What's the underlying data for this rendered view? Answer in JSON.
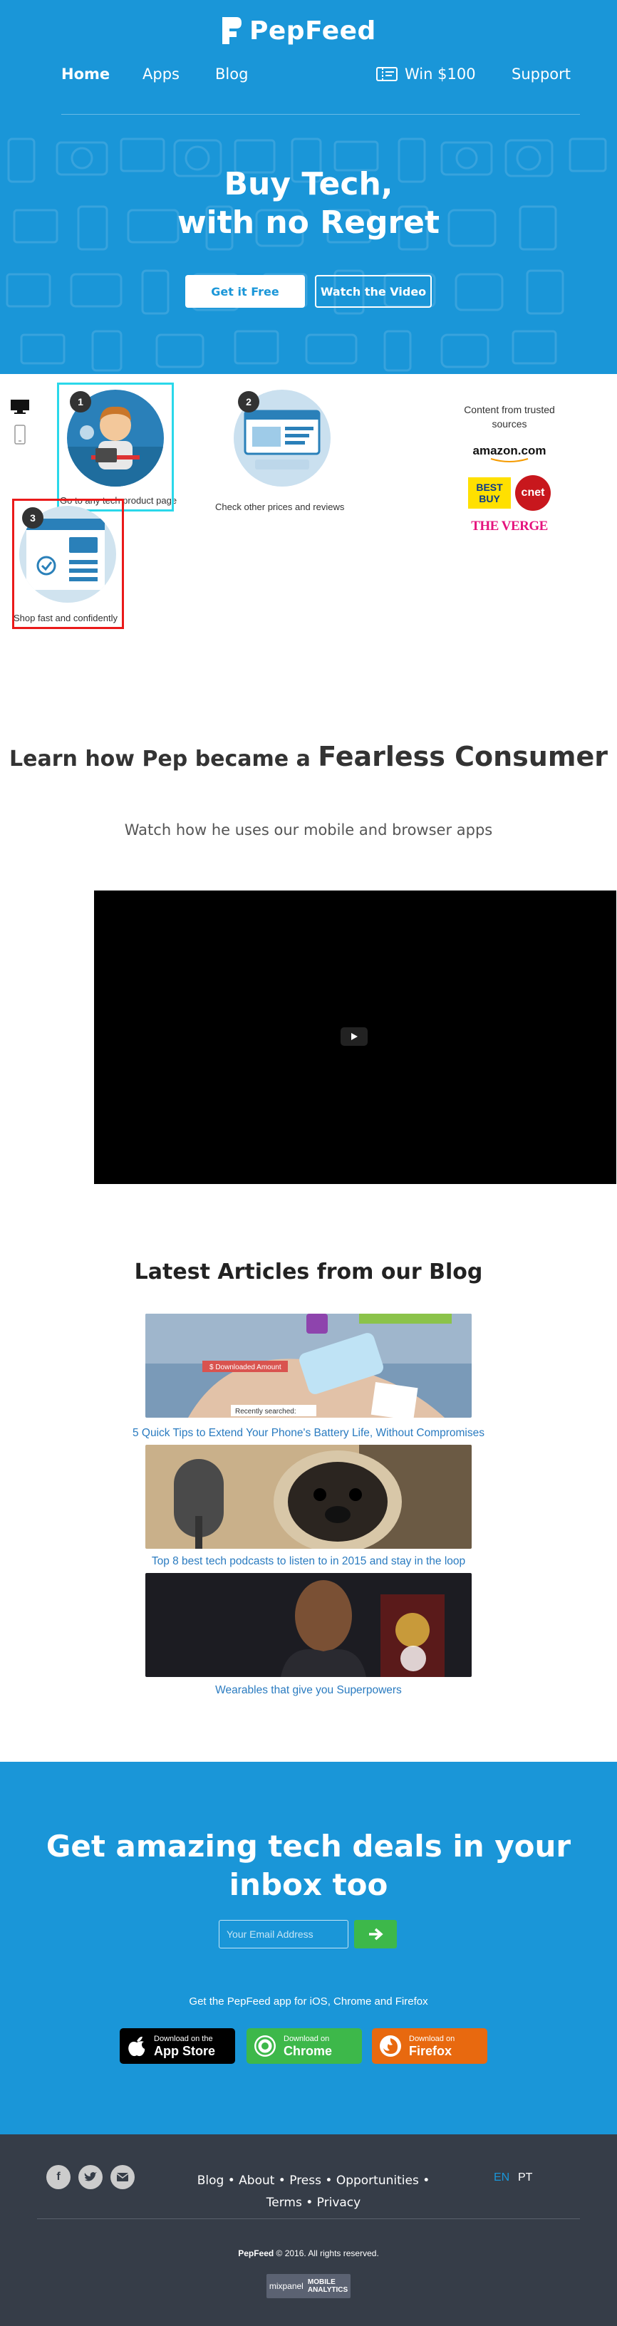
{
  "header": {
    "logo_text": "PepFeed",
    "nav": {
      "home": "Home",
      "apps": "Apps",
      "blog": "Blog",
      "win": "Win $100",
      "support": "Support"
    }
  },
  "hero": {
    "title_line1": "Buy Tech,",
    "title_line2": "with no Regret",
    "get_free_label": "Get it Free",
    "watch_video_label": "Watch the Video"
  },
  "steps": [
    {
      "number": "1",
      "label": "Go to any tech product page"
    },
    {
      "number": "2",
      "label": "Check other prices and reviews"
    },
    {
      "number": "3",
      "label": "Shop fast and confidently"
    }
  ],
  "trusted": {
    "caption": "Content from trusted sources",
    "sources": [
      "amazon.com",
      "BEST BUY",
      "cnet",
      "THE VERGE"
    ]
  },
  "learn": {
    "heading_prefix": "Learn how Pep became a",
    "heading_bold": "Fearless Consumer",
    "subtitle": "Watch how he uses our mobile and browser apps"
  },
  "blog": {
    "title": "Latest Articles from our Blog",
    "articles": [
      {
        "title": "5 Quick Tips to Extend Your Phone's Battery Life, Without Compromises",
        "badge": "$ Downloaded Amount",
        "search_label": "Recently searched:"
      },
      {
        "title": "Top 8 best tech podcasts to listen to in 2015 and stay in the loop"
      },
      {
        "title": "Wearables that give you Superpowers"
      }
    ]
  },
  "cta": {
    "title": "Get amazing tech deals in your inbox too",
    "email_placeholder": "Your Email Address",
    "apps_caption": "Get the PepFeed app for iOS, Chrome and Firefox",
    "stores": [
      {
        "small": "Download on the",
        "big": "App Store",
        "color": "#000000"
      },
      {
        "small": "Download on",
        "big": "Chrome",
        "color": "#3db84a"
      },
      {
        "small": "Download on",
        "big": "Firefox",
        "color": "#e8690f"
      }
    ]
  },
  "footer": {
    "links_line1": "Blog • About • Press • Opportunities •",
    "links_line2": "Terms • Privacy",
    "lang_en": "EN",
    "lang_pt": "PT",
    "copyright_brand": "PepFeed",
    "copyright_rest": " © 2016. All rights reserved.",
    "mixpanel_brand": "mixpanel",
    "mixpanel_sub1": "MOBILE",
    "mixpanel_sub2": "ANALYTICS"
  },
  "colors": {
    "brand_blue": "#1a96d8",
    "highlight_cyan": "#2ad8ea",
    "highlight_red": "#ea1a1a",
    "link_blue": "#2a7bc0",
    "footer_bg": "#363d48"
  }
}
